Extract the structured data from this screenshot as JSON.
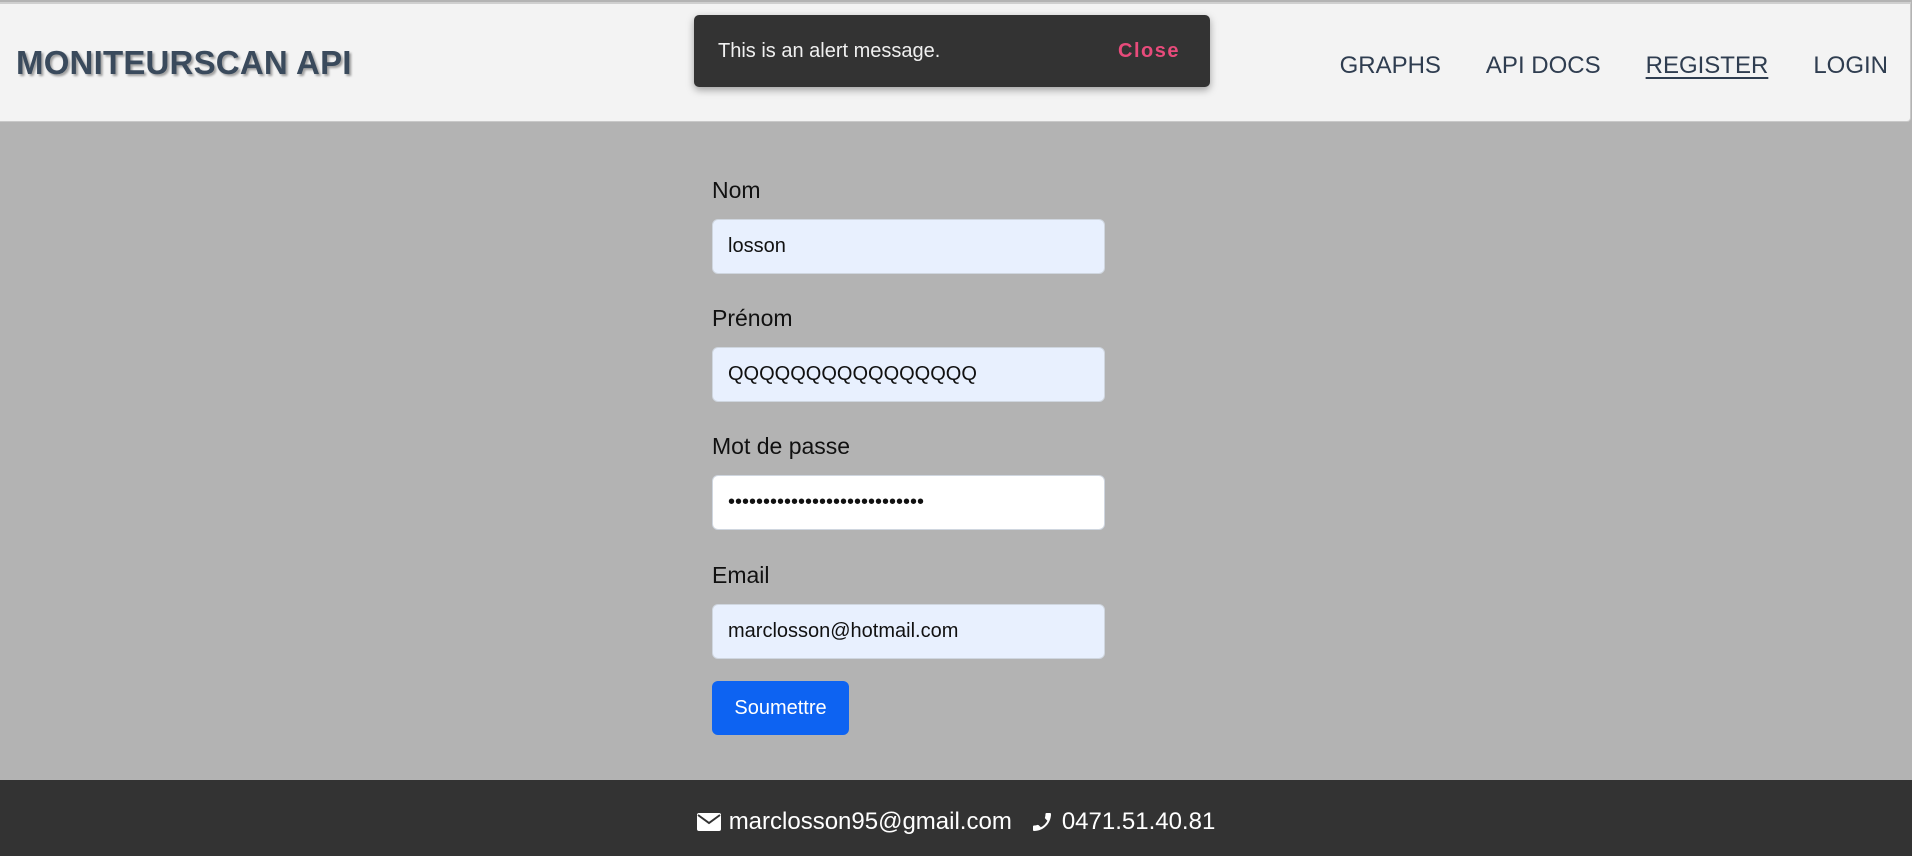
{
  "header": {
    "brand": "MONITEURSCAN API",
    "nav": [
      {
        "label": "GRAPHS"
      },
      {
        "label": "API DOCS"
      },
      {
        "label": "REGISTER"
      },
      {
        "label": "LOGIN"
      }
    ]
  },
  "toast": {
    "message": "This is an alert message.",
    "close_label": "Close"
  },
  "form": {
    "nom": {
      "label": "Nom",
      "value": "losson"
    },
    "prenom": {
      "label": "Prénom",
      "value": "QQQQQQQQQQQQQQQQ"
    },
    "password": {
      "label": "Mot de passe",
      "value": "••••••••••••••••••••••••••••"
    },
    "email": {
      "label": "Email",
      "value": "marclosson@hotmail.com"
    },
    "submit_label": "Soumettre"
  },
  "footer": {
    "email": "marclosson95@gmail.com",
    "phone": "0471.51.40.81",
    "icons": [
      "envelope-icon",
      "phone-icon"
    ]
  },
  "colors": {
    "header_bg": "#f3f3f3",
    "body_bg": "#b3b3b3",
    "footer_bg": "#333333",
    "toast_bg": "#333333",
    "close_accent": "#e84b7b",
    "submit_bg": "#0d63f2",
    "autofill_bg": "#e8f0fe"
  }
}
